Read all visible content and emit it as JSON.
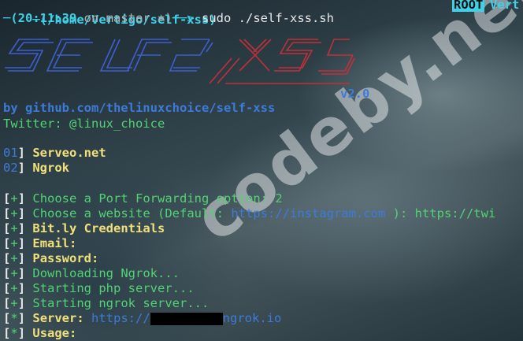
{
  "prompt": {
    "path_line": "─(/home/Vertigo/self-xss)",
    "root_badge": "ROOT",
    "user_label": "Vert",
    "time": "(20:11:39",
    "branch_text": " on master ",
    "branch_icon": "⎈)",
    "arrow": "──> ",
    "command": "sudo ./self-xss.sh"
  },
  "banner": {
    "version": "v2.0",
    "github": "by github.com/thelinuxchoice/self-xss",
    "twitter": "Twitter: @linux_choice"
  },
  "options": [
    {
      "num": "01",
      "label": "Serveo.net"
    },
    {
      "num": "02",
      "label": "Ngrok"
    }
  ],
  "log": {
    "choose_port": "Choose a Port Forwarding option: ",
    "choose_port_value": "2",
    "choose_site": "Choose a website (Default: ",
    "choose_site_default": "https://instagram.com",
    "choose_site_after": " ): ",
    "choose_site_value": "https://twi",
    "bitly": "Bit.ly Credentials",
    "email": "Email:",
    "password": "Password:",
    "downloading": "Downloading Ngrok...",
    "starting_php": "Starting php server...",
    "starting_ngrok": "Starting ngrok server...",
    "server_label": "Server: ",
    "server_url_start": "https://",
    "server_url_end": "ngrok.io",
    "usage": "Usage:"
  },
  "watermark": "codeby.net",
  "colors": {
    "green": "#52d273",
    "cyan": "#3fd0e8",
    "blue": "#3d7bd8",
    "yellow": "#f1e07a"
  }
}
